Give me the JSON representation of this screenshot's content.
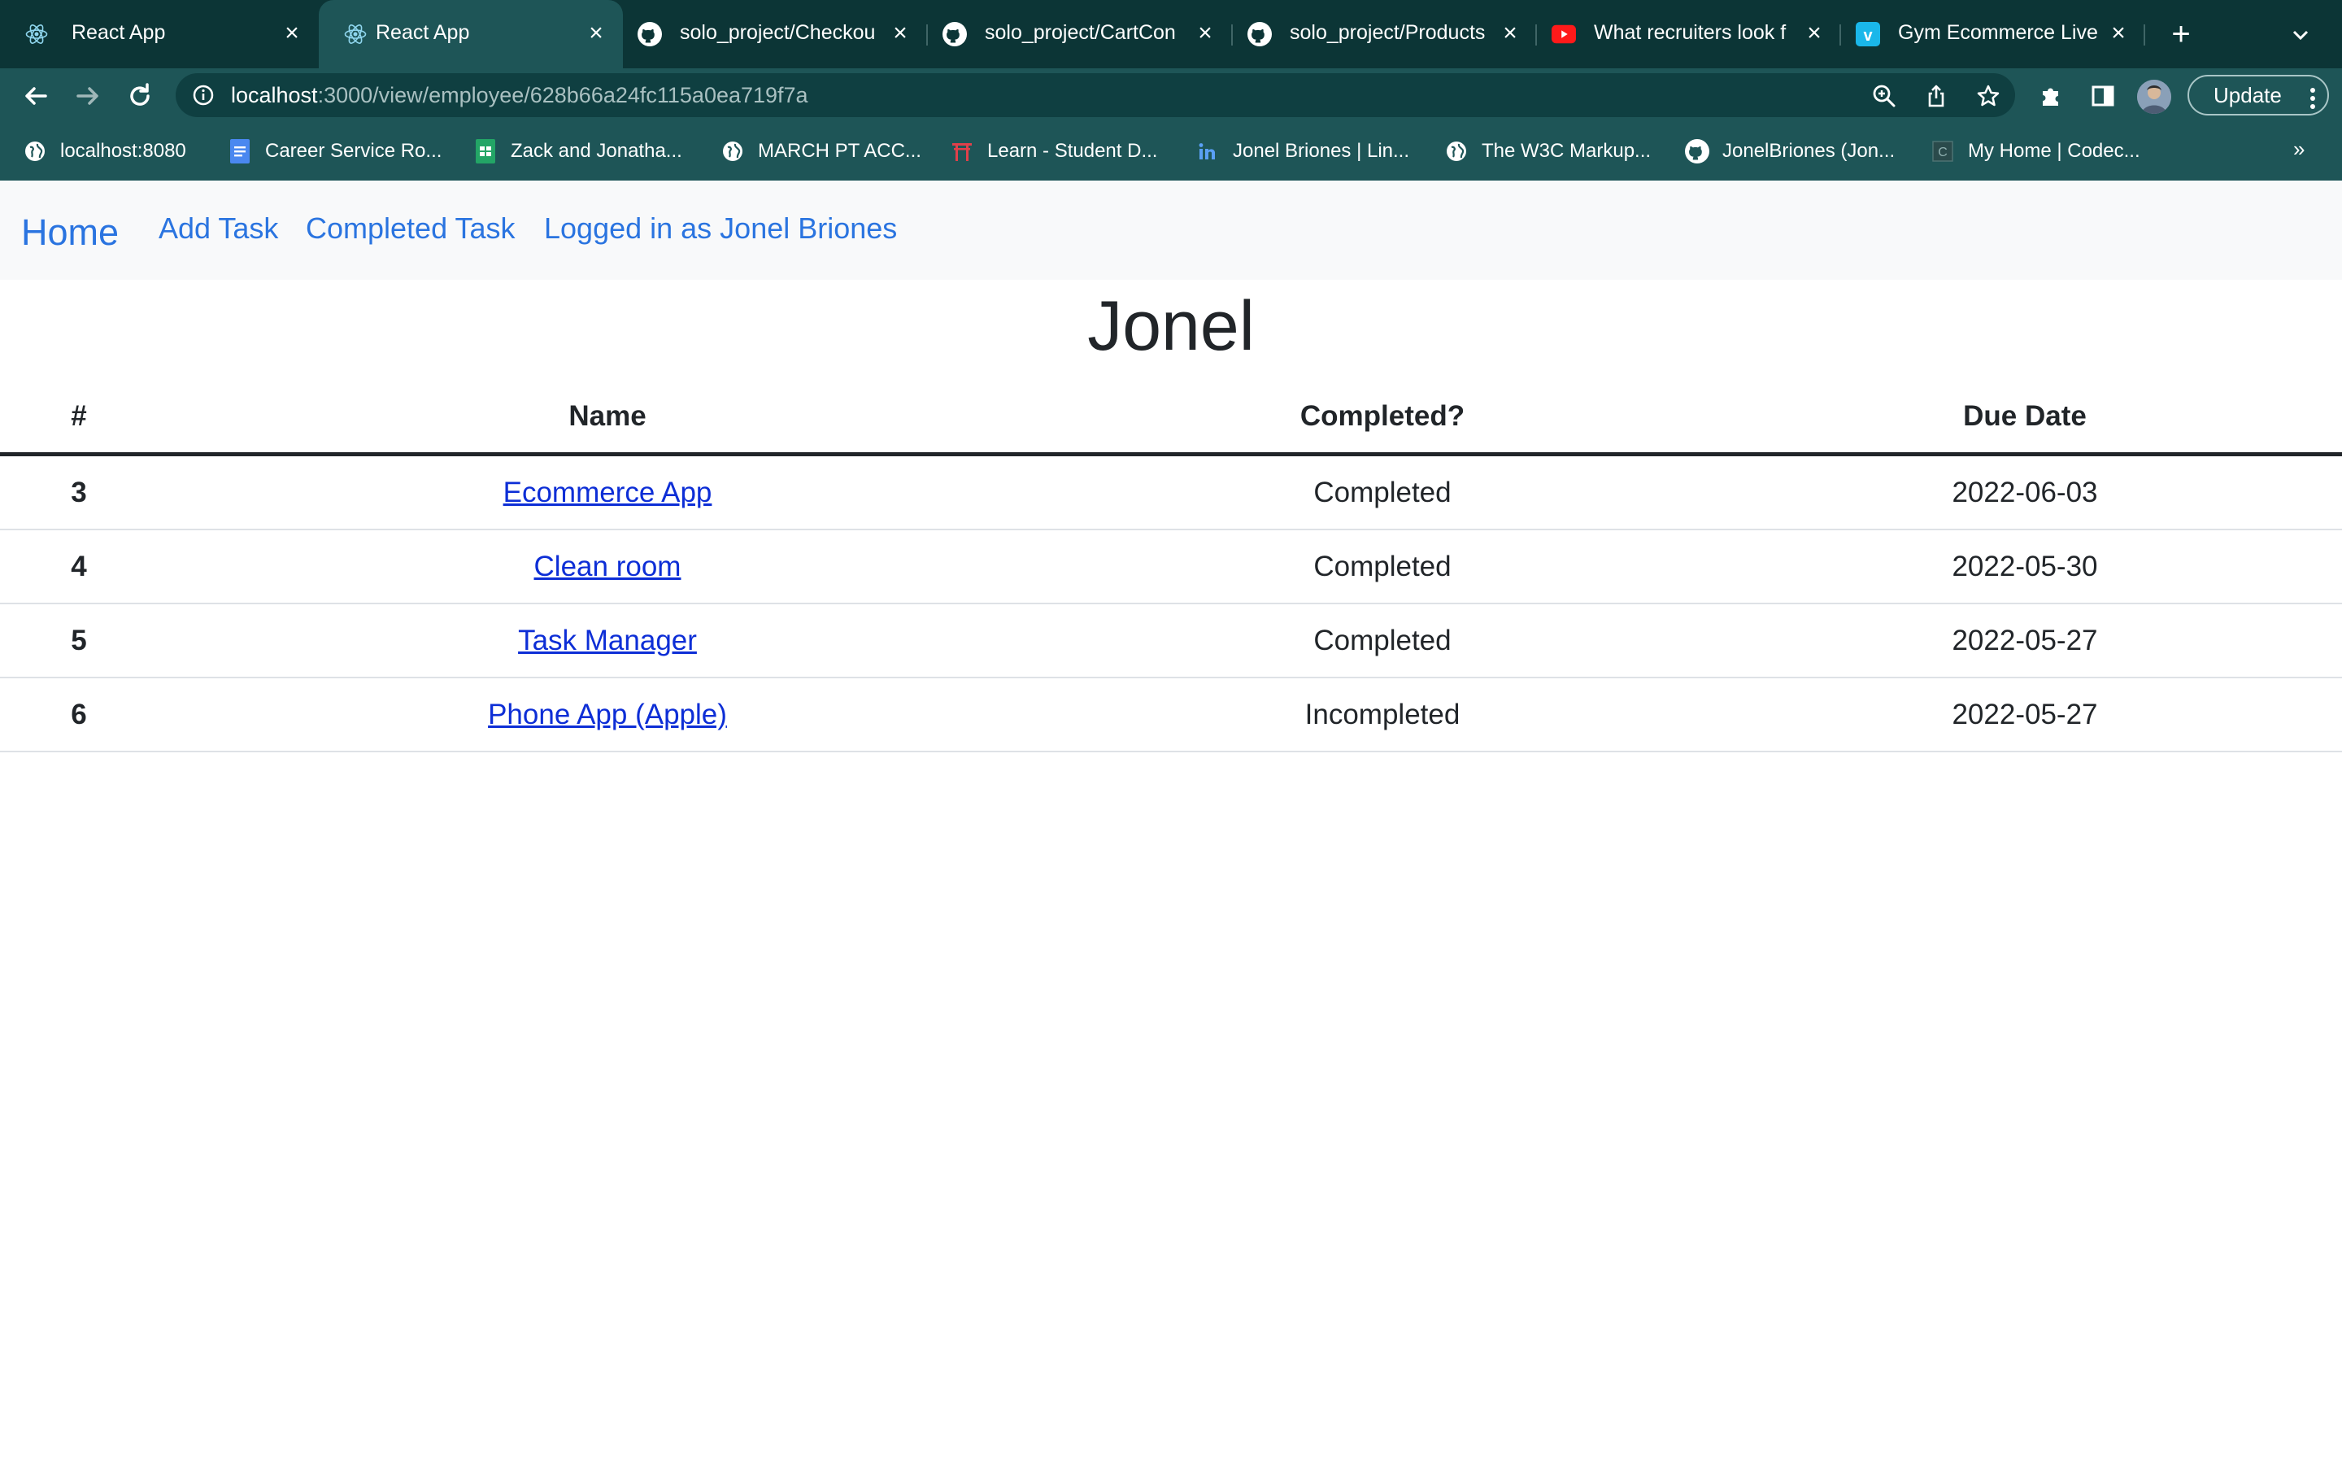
{
  "browser": {
    "tabs": [
      {
        "title": "React App",
        "favicon": "react-icon",
        "active": false
      },
      {
        "title": "React App",
        "favicon": "react-icon",
        "active": true
      },
      {
        "title": "solo_project/Checkou",
        "favicon": "github-icon",
        "active": false
      },
      {
        "title": "solo_project/CartCon",
        "favicon": "github-icon",
        "active": false
      },
      {
        "title": "solo_project/Products",
        "favicon": "github-icon",
        "active": false
      },
      {
        "title": "What recruiters look f",
        "favicon": "youtube-icon",
        "active": false
      },
      {
        "title": "Gym Ecommerce Live",
        "favicon": "vimeo-icon",
        "active": false
      }
    ],
    "url_host": "localhost",
    "url_path": ":3000/view/employee/628b66a24fc115a0ea719f7a",
    "update_label": "Update",
    "bookmarks": [
      {
        "label": "localhost:8080",
        "icon": "globe-icon"
      },
      {
        "label": "Career Service Ro...",
        "icon": "docs-icon"
      },
      {
        "label": "Zack and Jonatha...",
        "icon": "sheets-icon"
      },
      {
        "label": "MARCH PT ACC...",
        "icon": "globe-icon"
      },
      {
        "label": "Learn - Student D...",
        "icon": "torii-icon"
      },
      {
        "label": "Jonel Briones | Lin...",
        "icon": "linkedin-icon"
      },
      {
        "label": "The W3C Markup...",
        "icon": "globe-icon"
      },
      {
        "label": "JonelBriones (Jon...",
        "icon": "github-icon"
      },
      {
        "label": "My Home | Codec...",
        "icon": "codecademy-icon"
      }
    ],
    "bookmarks_overflow": "»"
  },
  "nav": {
    "brand": "Home",
    "links": [
      "Add Task",
      "Completed Task",
      "Logged in as Jonel Briones"
    ]
  },
  "page": {
    "heading": "Jonel"
  },
  "table": {
    "headers": [
      "#",
      "Name",
      "Completed?",
      "Due Date"
    ],
    "rows": [
      {
        "num": "3",
        "name": "Ecommerce App",
        "status": "Completed",
        "due": "2022-06-03"
      },
      {
        "num": "4",
        "name": "Clean room",
        "status": "Completed",
        "due": "2022-05-30"
      },
      {
        "num": "5",
        "name": "Task Manager",
        "status": "Completed",
        "due": "2022-05-27"
      },
      {
        "num": "6",
        "name": "Phone App (Apple)",
        "status": "Incompleted",
        "due": "2022-05-27"
      }
    ]
  },
  "colors": {
    "tabbar": "#0c3536",
    "toolbar": "#1e5557",
    "nav_link": "#2a74e0",
    "table_link": "#0d2ed6",
    "text": "#212529"
  }
}
